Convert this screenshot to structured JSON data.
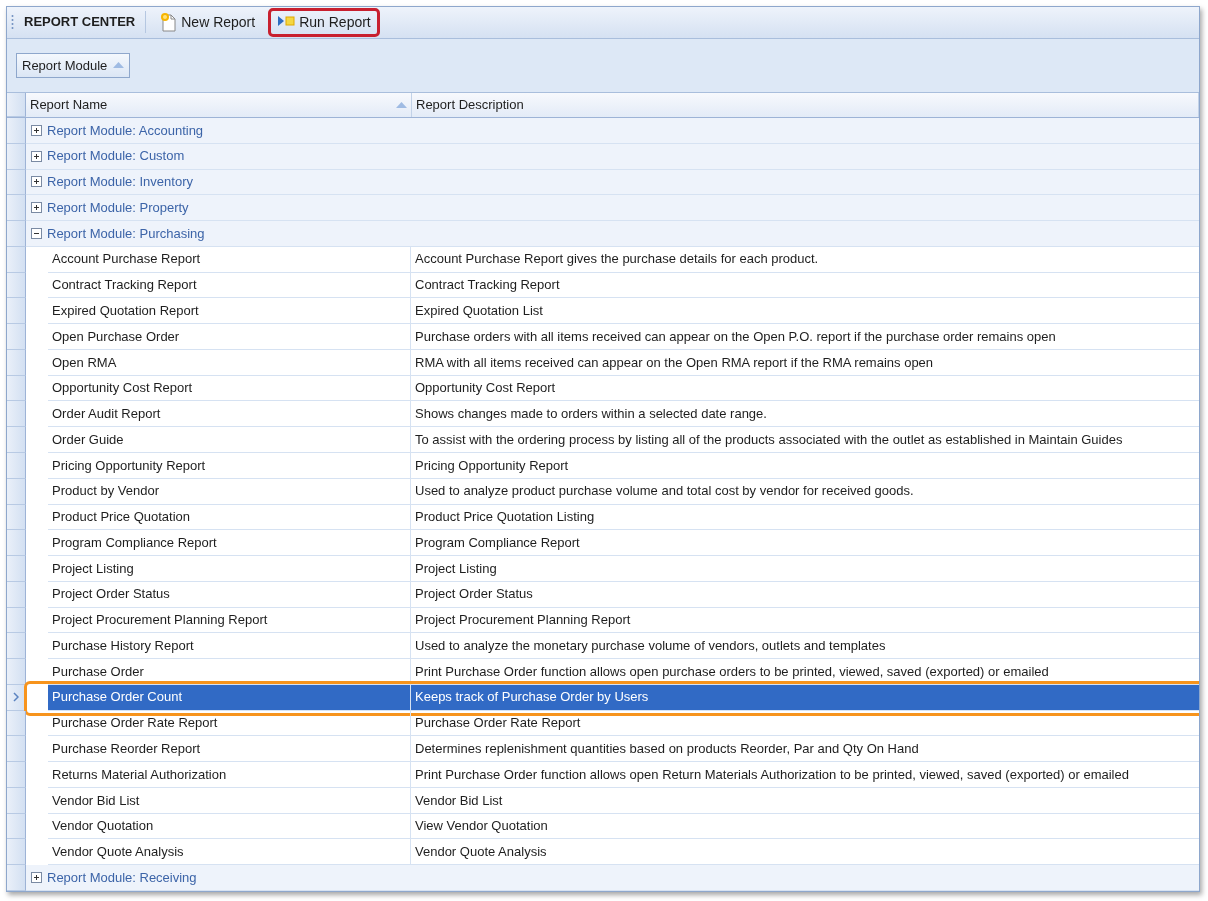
{
  "toolbar": {
    "title": "REPORT CENTER",
    "buttons": [
      {
        "label": "New Report",
        "kind": "new",
        "highlighted": false
      },
      {
        "label": "Run Report",
        "kind": "run",
        "highlighted": true
      }
    ]
  },
  "group_panel": {
    "chip": "Report Module"
  },
  "grid": {
    "columns": [
      {
        "label": "Report Name",
        "sorted": true
      },
      {
        "label": "Report Description",
        "sorted": false
      }
    ],
    "rows": [
      {
        "label": "Report Module: Accounting",
        "expanded": false
      },
      {
        "label": "Report Module: Custom",
        "expanded": false
      },
      {
        "label": "Report Module: Inventory",
        "expanded": false
      },
      {
        "label": "Report Module: Property",
        "expanded": false
      },
      {
        "label": "Report Module: Purchasing",
        "expanded": true,
        "children": [
          {
            "name": "Account Purchase Report",
            "description": "Account Purchase Report gives the purchase details for each product.",
            "selected": false,
            "highlighted": false
          },
          {
            "name": "Contract Tracking Report",
            "description": "Contract Tracking Report",
            "selected": false,
            "highlighted": false
          },
          {
            "name": "Expired Quotation Report",
            "description": "Expired Quotation List",
            "selected": false,
            "highlighted": false
          },
          {
            "name": "Open Purchase Order",
            "description": "Purchase orders with all items received can appear on the Open P.O. report if the purchase order remains open",
            "selected": false,
            "highlighted": false
          },
          {
            "name": "Open RMA",
            "description": "RMA with all items received can appear on the Open RMA report if the RMA remains open",
            "selected": false,
            "highlighted": false
          },
          {
            "name": "Opportunity Cost Report",
            "description": "Opportunity Cost Report",
            "selected": false,
            "highlighted": false
          },
          {
            "name": "Order Audit Report",
            "description": "Shows changes made to orders within a selected date range.",
            "selected": false,
            "highlighted": false
          },
          {
            "name": "Order Guide",
            "description": "To assist with the ordering process by listing all of the products associated with the outlet as established in Maintain Guides",
            "selected": false,
            "highlighted": false
          },
          {
            "name": "Pricing Opportunity Report",
            "description": "Pricing Opportunity Report",
            "selected": false,
            "highlighted": false
          },
          {
            "name": "Product by Vendor",
            "description": "Used to analyze product purchase volume and total cost by vendor for received goods.",
            "selected": false,
            "highlighted": false
          },
          {
            "name": "Product Price Quotation",
            "description": "Product Price Quotation Listing",
            "selected": false,
            "highlighted": false
          },
          {
            "name": "Program Compliance Report",
            "description": "Program Compliance Report",
            "selected": false,
            "highlighted": false
          },
          {
            "name": "Project Listing",
            "description": "Project Listing",
            "selected": false,
            "highlighted": false
          },
          {
            "name": "Project Order Status",
            "description": "Project Order Status",
            "selected": false,
            "highlighted": false
          },
          {
            "name": "Project Procurement Planning Report",
            "description": "Project Procurement Planning Report",
            "selected": false,
            "highlighted": false
          },
          {
            "name": "Purchase History Report",
            "description": "Used to analyze the monetary purchase volume of vendors, outlets and templates",
            "selected": false,
            "highlighted": false
          },
          {
            "name": "Purchase Order",
            "description": "Print Purchase Order function allows open purchase orders to be printed, viewed, saved (exported) or emailed",
            "selected": false,
            "highlighted": false
          },
          {
            "name": "Purchase Order Count",
            "description": "Keeps track of Purchase Order by Users",
            "selected": true,
            "highlighted": true
          },
          {
            "name": "Purchase Order Rate Report",
            "description": "Purchase Order Rate Report",
            "selected": false,
            "highlighted": false
          },
          {
            "name": "Purchase Reorder Report",
            "description": "Determines replenishment quantities based on products Reorder, Par and Qty On Hand",
            "selected": false,
            "highlighted": false
          },
          {
            "name": "Returns Material Authorization",
            "description": "Print Purchase Order function allows open Return Materials Authorization to be printed, viewed, saved (exported) or emailed",
            "selected": false,
            "highlighted": false
          },
          {
            "name": "Vendor Bid List",
            "description": "Vendor Bid List",
            "selected": false,
            "highlighted": false
          },
          {
            "name": "Vendor Quotation",
            "description": "View Vendor Quotation",
            "selected": false,
            "highlighted": false
          },
          {
            "name": "Vendor Quote Analysis",
            "description": "Vendor Quote Analysis",
            "selected": false,
            "highlighted": false
          }
        ]
      },
      {
        "label": "Report Module: Receiving",
        "expanded": false
      }
    ]
  }
}
